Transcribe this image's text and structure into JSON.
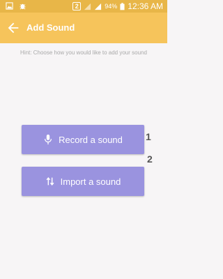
{
  "status_bar": {
    "sim_slot": "2",
    "battery_percent": "94%",
    "time": "12:36 AM"
  },
  "app_bar": {
    "title": "Add Sound",
    "back_icon": "arrow-left-icon"
  },
  "hint": "Hint: Choose how you would like to add your sound",
  "actions": [
    {
      "label": "Record a sound",
      "icon": "microphone-icon",
      "marker": "1"
    },
    {
      "label": "Import a sound",
      "icon": "swap-vertical-icon",
      "marker": "2"
    }
  ],
  "colors": {
    "status_bar": "#e8b648",
    "app_bar": "#f6c45b",
    "button": "#9a93df",
    "background": "#f7f5f6"
  }
}
